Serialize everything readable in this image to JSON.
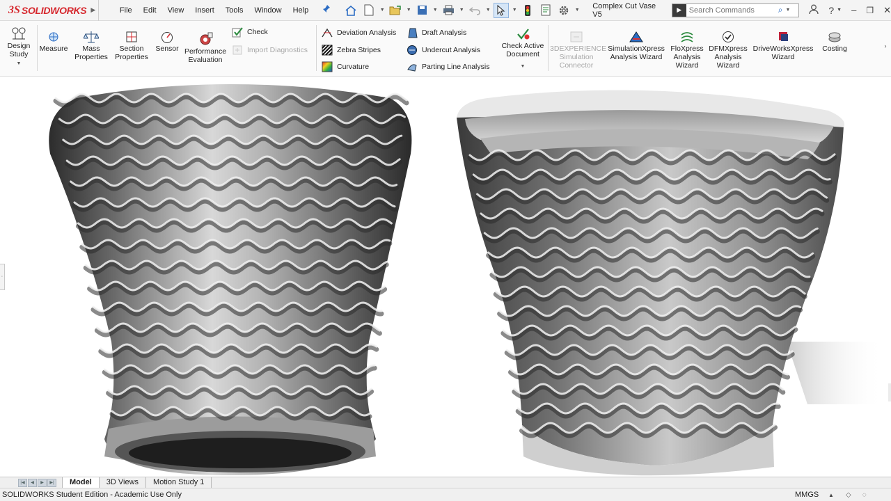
{
  "app": {
    "brand_ds": "3S",
    "brand_name": "SOLIDWORKS",
    "document_title": "Complex Cut Vase V5"
  },
  "menu": [
    "File",
    "Edit",
    "View",
    "Insert",
    "Tools",
    "Window",
    "Help"
  ],
  "search": {
    "placeholder": "Search Commands"
  },
  "ribbon": {
    "design_study": "Design Study",
    "measure": "Measure",
    "mass_properties": "Mass Properties",
    "section_properties": "Section Properties",
    "sensor": "Sensor",
    "performance_evaluation": "Performance Evaluation",
    "check": "Check",
    "import_diagnostics": "Import Diagnostics",
    "deviation_analysis": "Deviation Analysis",
    "zebra_stripes": "Zebra Stripes",
    "curvature": "Curvature",
    "draft_analysis": "Draft Analysis",
    "undercut_analysis": "Undercut Analysis",
    "parting_line_analysis": "Parting Line Analysis",
    "check_active_document": "Check Active Document",
    "experience_connector": "3DEXPERIENCE Simulation Connector",
    "simulationxpress": "SimulationXpress Analysis Wizard",
    "floxpress": "FloXpress Analysis Wizard",
    "dfmxpress": "DFMXpress Analysis Wizard",
    "driveworksxpress": "DriveWorksXpress Wizard",
    "costing": "Costing"
  },
  "tabs": [
    "Model",
    "3D Views",
    "Motion Study 1"
  ],
  "status": {
    "edition": "SOLIDWORKS Student Edition - Academic Use Only",
    "units": "MMGS"
  },
  "colors": {
    "brand": "#d6282e",
    "accent": "#2b6cc4",
    "vase_metal": "#8a8a8a"
  }
}
